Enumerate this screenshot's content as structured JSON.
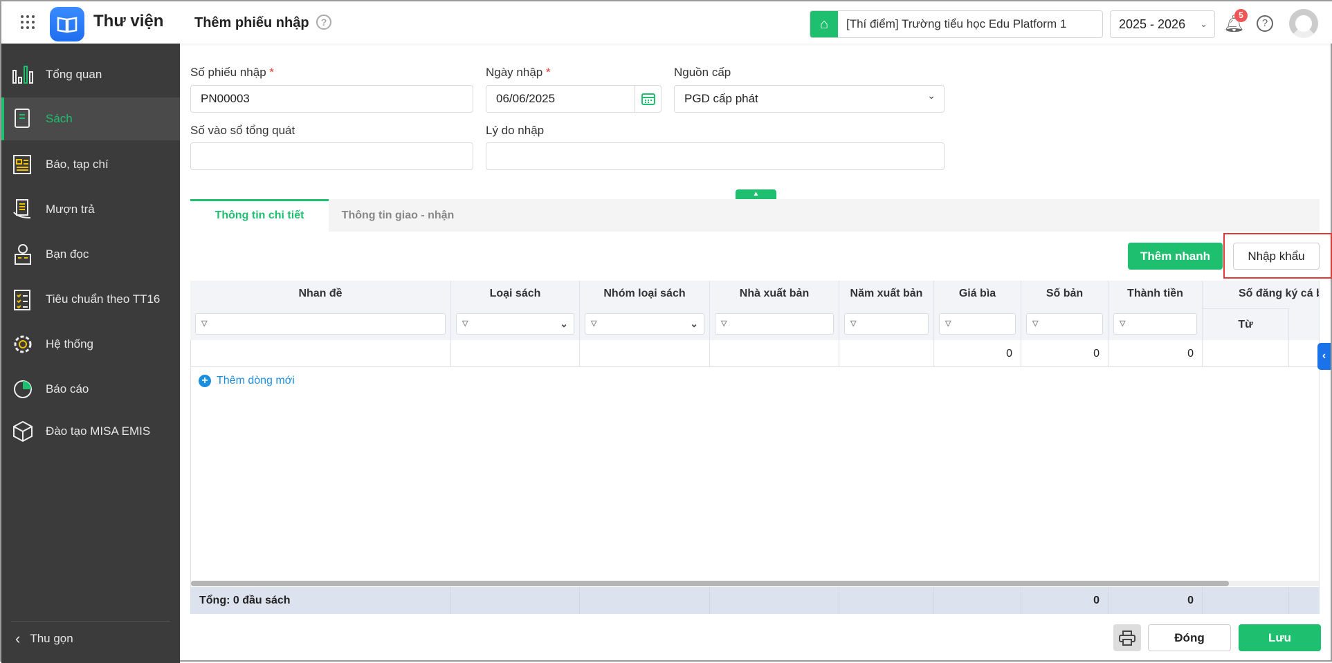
{
  "header": {
    "app_title": "Thư viện",
    "page_title": "Thêm phiếu nhập",
    "school": "[Thí điểm] Trường tiểu học Edu Platform 1",
    "year": "2025 - 2026",
    "notification_count": "5"
  },
  "sidebar": {
    "items": [
      {
        "label": "Tổng quan"
      },
      {
        "label": "Sách"
      },
      {
        "label": "Báo, tạp chí"
      },
      {
        "label": "Mượn trả"
      },
      {
        "label": "Bạn đọc"
      },
      {
        "label": "Tiêu chuẩn theo TT16"
      },
      {
        "label": "Hệ thống"
      },
      {
        "label": "Báo cáo"
      },
      {
        "label": "Đào tạo MISA EMIS"
      }
    ],
    "collapse_label": "Thu gọn"
  },
  "form": {
    "so_phieu_label": "Số phiếu nhập",
    "so_phieu_value": "PN00003",
    "ngay_label": "Ngày nhập",
    "ngay_value": "06/06/2025",
    "nguon_label": "Nguồn cấp",
    "nguon_value": "PGD cấp phát",
    "so_vao_so_label": "Số vào sổ tổng quát",
    "ly_do_label": "Lý do nhập",
    "required_mark": "*"
  },
  "tabs": [
    {
      "label": "Thông tin chi tiết"
    },
    {
      "label": "Thông tin giao - nhận"
    }
  ],
  "actions": {
    "quick_add": "Thêm nhanh",
    "import": "Nhập khẩu",
    "add_row": "Thêm dòng mới",
    "close": "Đóng",
    "save": "Lưu"
  },
  "table": {
    "columns": [
      "Nhan đề",
      "Loại sách",
      "Nhóm loại sách",
      "Nhà xuất bản",
      "Năm xuất bản",
      "Giá bìa",
      "Số bản",
      "Thành tiền",
      "Số đăng ký cá biệt"
    ],
    "sub_column": "Từ",
    "row": {
      "gia_bia": "0",
      "so_ban": "0",
      "thanh_tien": "0"
    },
    "footer": {
      "total_label": "Tổng: 0 đầu sách",
      "so_ban": "0",
      "thanh_tien": "0"
    }
  },
  "colors": {
    "accent": "#1fbf70",
    "brand": "#2b7cf6",
    "highlight": "#e53935"
  }
}
